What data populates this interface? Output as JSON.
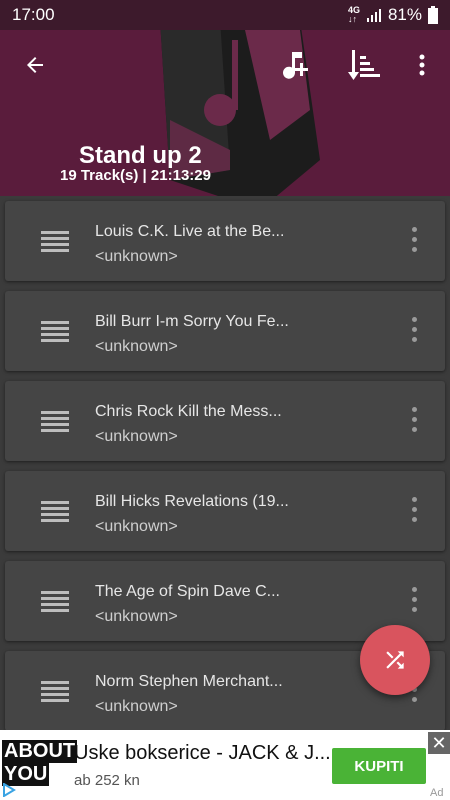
{
  "status": {
    "time": "17:00",
    "network_top": "4G",
    "battery": "81%"
  },
  "header": {
    "title": "Stand up 2",
    "subtitle": "19 Track(s) | 21:13:29",
    "icons": [
      "back-arrow-icon",
      "add-music-icon",
      "sort-icon",
      "more-vert-icon"
    ],
    "colors": {
      "background": "#5a1c3c",
      "status_bar": "#3d1a2c"
    }
  },
  "tracks": [
    {
      "title": "Louis C.K. Live at the Be...",
      "artist": "<unknown>"
    },
    {
      "title": "Bill Burr I-m Sorry You Fe...",
      "artist": "<unknown>"
    },
    {
      "title": "Chris Rock Kill the Mess...",
      "artist": "<unknown>"
    },
    {
      "title": "Bill Hicks Revelations (19...",
      "artist": "<unknown>"
    },
    {
      "title": "The Age of Spin Dave C...",
      "artist": "<unknown>"
    },
    {
      "title": "Norm Stephen Merchant...",
      "artist": "<unknown>"
    }
  ],
  "fab": {
    "icon": "shuffle-icon",
    "color": "#d9545e"
  },
  "ad": {
    "logo_line1": "ABOUT",
    "logo_line2": "YOU",
    "title": "Uske bokserice - JACK & J...",
    "price": "ab 252 kn",
    "cta": "KUPITI",
    "label": "Ad",
    "cta_color": "#4ab336"
  }
}
